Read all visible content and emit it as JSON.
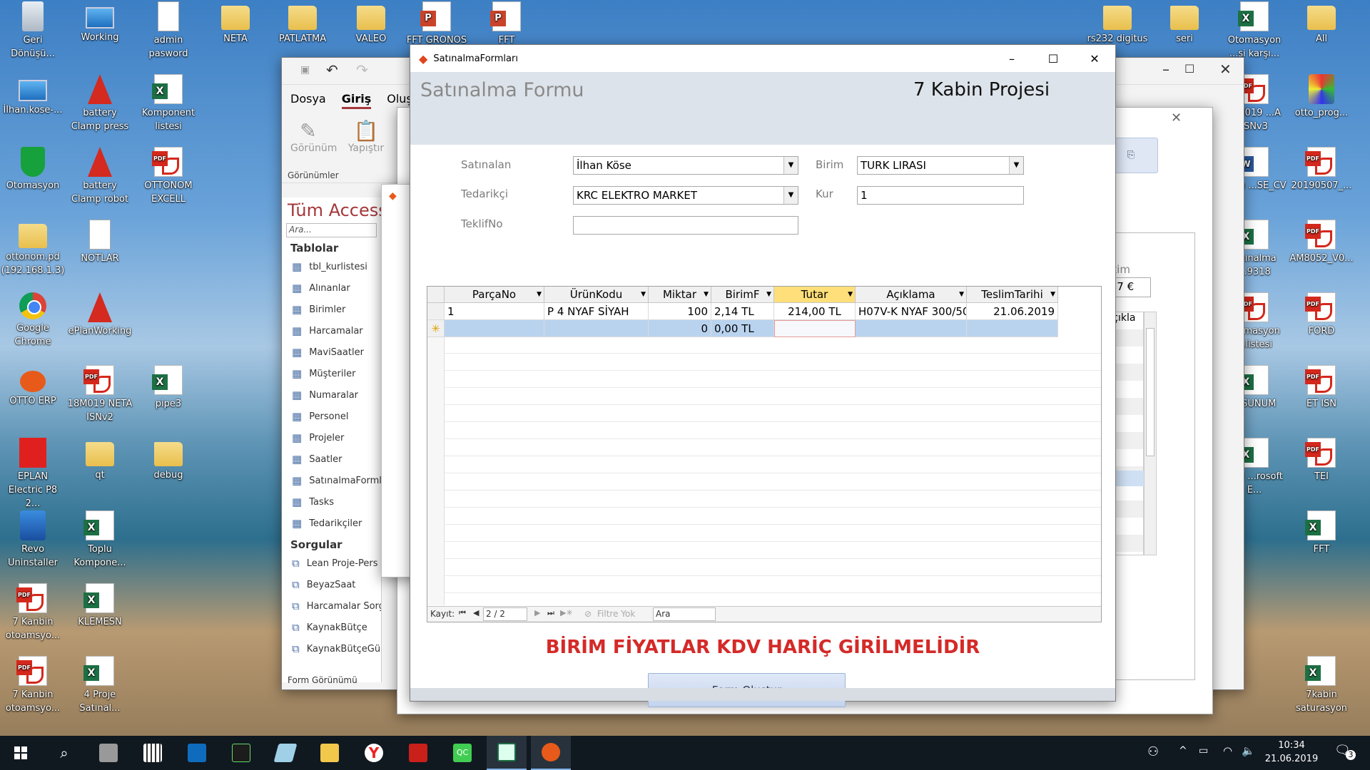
{
  "desktop_icons": [
    {
      "label": "Geri Dönüşü...",
      "icon": "recycle-bin"
    },
    {
      "label": "Working",
      "icon": "computer"
    },
    {
      "label": "admin pasword",
      "icon": "text-file"
    },
    {
      "label": "NETA",
      "icon": "folder"
    },
    {
      "label": "PATLATMA",
      "icon": "folder"
    },
    {
      "label": "VALEO",
      "icon": "folder"
    },
    {
      "label": "FFT GRONOS",
      "icon": "powerpoint"
    },
    {
      "label": "FFT",
      "icon": "powerpoint"
    },
    {
      "label": "İlhan.kose-...",
      "icon": "network-drive"
    },
    {
      "label": "battery Clamp press",
      "icon": "eplan-file"
    },
    {
      "label": "Komponent listesi",
      "icon": "excel"
    },
    {
      "label": "Otomasyon",
      "icon": "shield"
    },
    {
      "label": "battery Clamp robot",
      "icon": "eplan-file"
    },
    {
      "label": "OTTONOM EXCELL",
      "icon": "pdf"
    },
    {
      "label": "ottonom.pd (192.168.1.3)",
      "icon": "folder"
    },
    {
      "label": "NOTLAR",
      "icon": "text-file"
    },
    {
      "label": "Google Chrome",
      "icon": "chrome"
    },
    {
      "label": "ePlanWorking",
      "icon": "eplan-file"
    },
    {
      "label": "OTTO ERP",
      "icon": "otto-erp"
    },
    {
      "label": "18M019 NETA ISNv2",
      "icon": "pdf"
    },
    {
      "label": "pipe3",
      "icon": "excel"
    },
    {
      "label": "EPLAN Electric P8 2...",
      "icon": "eplan"
    },
    {
      "label": "qt",
      "icon": "folder"
    },
    {
      "label": "debug",
      "icon": "folder"
    },
    {
      "label": "Revo Uninstaller",
      "icon": "revo"
    },
    {
      "label": "Toplu Kompone...",
      "icon": "excel"
    },
    {
      "label": "7 Kanbin otoamsyo...",
      "icon": "pdf"
    },
    {
      "label": "KLEMESN",
      "icon": "excel"
    },
    {
      "label": "7 Kanbin otoamsyo...",
      "icon": "pdf"
    },
    {
      "label": "4 Proje Satınal...",
      "icon": "excel"
    },
    {
      "label": "rs232 digitus",
      "icon": "folder"
    },
    {
      "label": "seri",
      "icon": "folder"
    },
    {
      "label": "Otomasyon ...si karşı...",
      "icon": "excel"
    },
    {
      "label": "All",
      "icon": "folder"
    },
    {
      "label": "...M019 ...A ISNv3",
      "icon": "pdf"
    },
    {
      "label": "otto_prog...",
      "icon": "cube"
    },
    {
      "label": "İlhan ...SE_CV",
      "icon": "word"
    },
    {
      "label": "20190507_...",
      "icon": "pdf"
    },
    {
      "label": "...tınalma ...9318",
      "icon": "excel"
    },
    {
      "label": "AM8052_V0...",
      "icon": "pdf"
    },
    {
      "label": "...omasyon ...listesi",
      "icon": "pdf"
    },
    {
      "label": "FORD",
      "icon": "pdf"
    },
    {
      "label": "...SUNUM",
      "icon": "excel"
    },
    {
      "label": "ET ISN",
      "icon": "pdf"
    },
    {
      "label": "Yeni ...rosoft E...",
      "icon": "excel"
    },
    {
      "label": "TEI",
      "icon": "pdf"
    },
    {
      "label": "FFT",
      "icon": "excel"
    },
    {
      "label": "7kabin saturasyon",
      "icon": "excel"
    }
  ],
  "access_window": {
    "tabs": [
      "Dosya",
      "Giriş",
      "Oluş"
    ],
    "active_tab": "Giriş",
    "ribbon_buttons": [
      "Görünüm",
      "Yapıştır"
    ],
    "group_label": "Görünümler",
    "nav_title": "Tüm Access",
    "search_placeholder": "Ara...",
    "section_tables": "Tablolar",
    "tables": [
      "tbl_kurlistesi",
      "Alınanlar",
      "Birimler",
      "Harcamalar",
      "MaviSaatler",
      "Müşteriler",
      "Numaralar",
      "Personel",
      "Projeler",
      "Saatler",
      "SatınalmaForml",
      "Tasks",
      "Tedarikçiler"
    ],
    "section_queries": "Sorgular",
    "queries": [
      "Lean Proje-Pers",
      "BeyazSaat",
      "Harcamalar Sorgu",
      "KaynakBütçe",
      "KaynakBütçeGün"
    ],
    "status": "Form Görünümü"
  },
  "back_dialog": {
    "partial_label": "...tim",
    "partial_value": ",17 €",
    "partial_column": "Açıkla"
  },
  "form_window": {
    "title": "SatınalmaFormları",
    "header_title": "Satınalma Formu",
    "project_title": "7 Kabin Projesi",
    "labels": {
      "satinalan": "Satınalan",
      "tedarikci": "Tedarikçi",
      "teklifno": "TeklifNo",
      "birim": "Birim",
      "kur": "Kur"
    },
    "values": {
      "satinalan": "İlhan Köse",
      "tedarikci": "KRC ELEKTRO MARKET",
      "teklifno": "",
      "birim": "TURK LIRASI",
      "kur": "1"
    },
    "grid": {
      "columns": [
        "ParçaNo",
        "ÜrünKodu",
        "Miktar",
        "BirimF",
        "Tutar",
        "Açıklama",
        "TeslimTarihi"
      ],
      "rows": [
        [
          "1",
          "P 4 NYAF SİYAH",
          "100",
          "2,14 TL",
          "214,00 TL",
          "H07V-K NYAF 300/500",
          "21.06.2019"
        ],
        [
          "",
          "",
          "0",
          "0,00 TL",
          "",
          "",
          ""
        ]
      ],
      "nav": {
        "record_label": "Kayıt:",
        "record_value": "2 / 2",
        "filter_label": "Filtre Yok",
        "search_label": "Ara"
      }
    },
    "warning": "BİRİM FİYATLAR KDV HARİÇ GİRİLMELİDİR",
    "submit_label": "Form Oluştur",
    "warning_color": "#d42a28"
  },
  "taskbar": {
    "apps": [
      "search",
      "printer",
      "calculator",
      "outlook",
      "terminal",
      "notepad",
      "file-explorer",
      "yandex",
      "acrobat",
      "qt-creator",
      "excel-window",
      "otto-erp"
    ],
    "time": "10:34",
    "date": "21.06.2019",
    "notifications": "3"
  }
}
